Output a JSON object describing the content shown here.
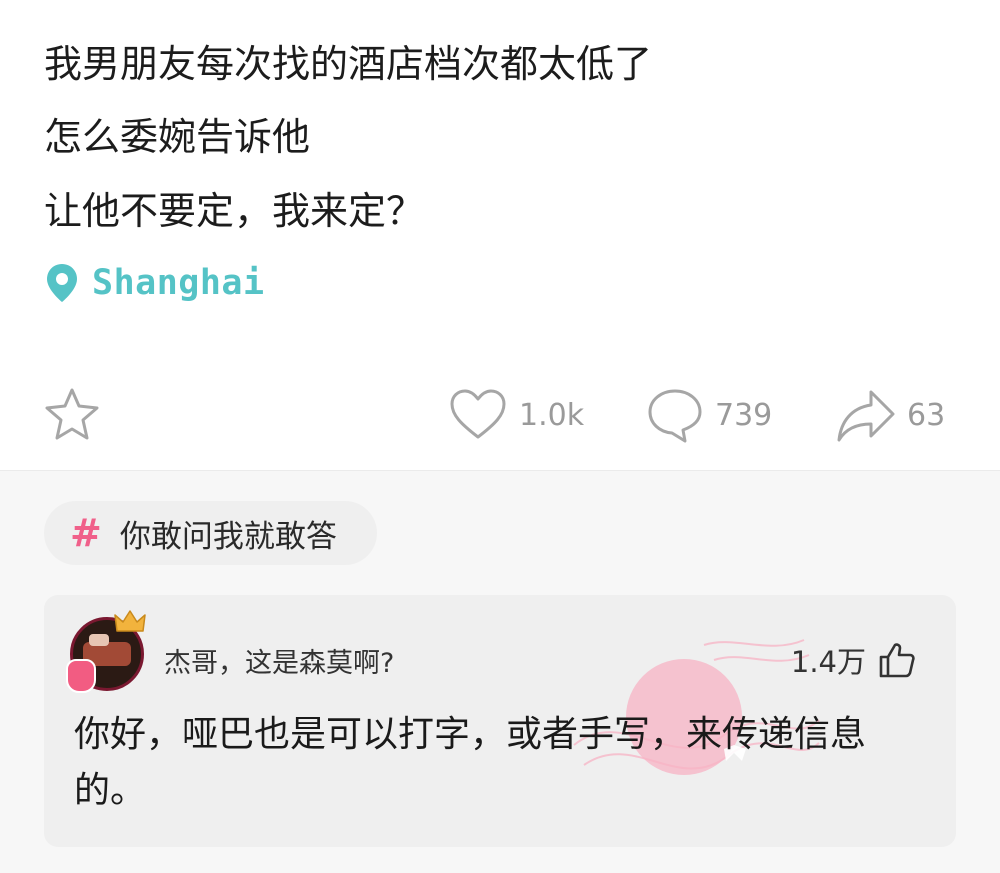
{
  "post": {
    "lines": [
      "我男朋友每次找的酒店档次都太低了",
      "怎么委婉告诉他",
      "让他不要定，我来定？"
    ],
    "location": "Shanghai",
    "location_icon": "map-pin-icon"
  },
  "actions": {
    "favorite_icon": "star-icon",
    "like_count": "1.0k",
    "comment_count": "739",
    "share_count": "63"
  },
  "topic": {
    "hash": "#",
    "label": "你敢问我就敢答"
  },
  "comment": {
    "username": "杰哥，这是森莫啊?",
    "like_count": "1.4万",
    "badge_icon": "hot-comment-stamp",
    "text": "你好，哑巴也是可以打字，或者手写，来传递信息的。"
  },
  "colors": {
    "accent_teal": "#55c3c6",
    "topic_pink": "#f0608a",
    "muted_gray": "#9a9a9a"
  }
}
